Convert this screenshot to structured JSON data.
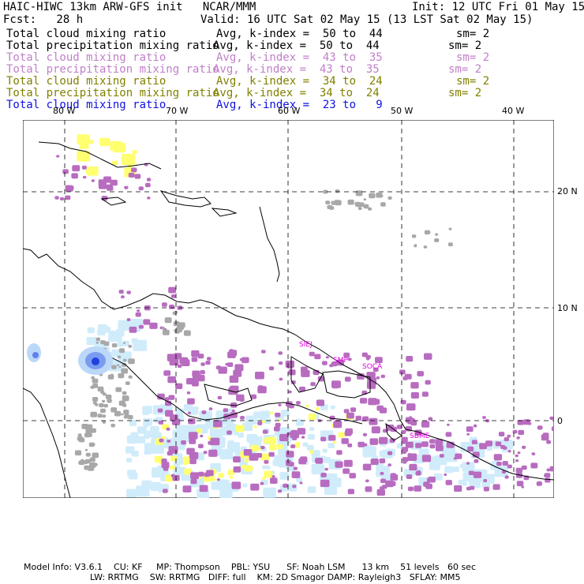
{
  "header": {
    "title": "HAIC-HIWC 13km ARW-GFS init   NCAR/MMM",
    "init": "Init: 12 UTC Fri 01 May 15",
    "fcst": "Fcst:   28 h",
    "valid": "Valid: 16 UTC Sat 02 May 15 (13 LST Sat 02 May 15)"
  },
  "legend": [
    {
      "field": "Total cloud mixing ratio",
      "avg": "Avg, k-index =  50 to  44",
      "sm": "sm= 2",
      "color": "#000000"
    },
    {
      "field": "Total precipitation mixing ratio",
      "avg": "Avg, k-index =  50 to  44",
      "sm": "sm= 2",
      "color": "#000000"
    },
    {
      "field": "Total cloud mixing ratio",
      "avg": "Avg, k-index =  43 to  35",
      "sm": "sm= 2",
      "color": "#c080c8"
    },
    {
      "field": "Total precipitation mixing ratio",
      "avg": "Avg, k-index =  43 to  35",
      "sm": "sm= 2",
      "color": "#c080c8"
    },
    {
      "field": "Total cloud mixing ratio",
      "avg": "Avg, k-index =  34 to  24",
      "sm": "sm= 2",
      "color": "#808000"
    },
    {
      "field": "Total precipitation mixing ratio",
      "avg": "Avg, k-index =  34 to  24",
      "sm": "sm= 2",
      "color": "#808000"
    },
    {
      "field": "Total cloud mixing ratio",
      "avg": "Avg, k-index =  23 to   9",
      "sm": "",
      "color": "#1010e0"
    }
  ],
  "map": {
    "lon_labels": [
      "80 W",
      "70 W",
      "60 W",
      "50 W",
      "40 W"
    ],
    "lat_labels": [
      "20 N",
      "10 N",
      "0"
    ],
    "cities": [
      "SIEJ",
      "SMP",
      "SOCA",
      "SBME"
    ],
    "colors": {
      "gray": "#a8a8a8",
      "purple": "#b86cc0",
      "yellow": "#ffff70",
      "lightblue": "#d0ecfb",
      "blue": "#3050e8"
    }
  },
  "footer": {
    "line1": "Model Info: V3.6.1    CU: KF     MP: Thompson    PBL: YSU      SF: Noah LSM      13 km    51 levels   60 sec",
    "line2": "LW: RRTMG    SW: RRTMG   DIFF: full    KM: 2D Smagor DAMP: Rayleigh3   SFLAY: MM5"
  }
}
